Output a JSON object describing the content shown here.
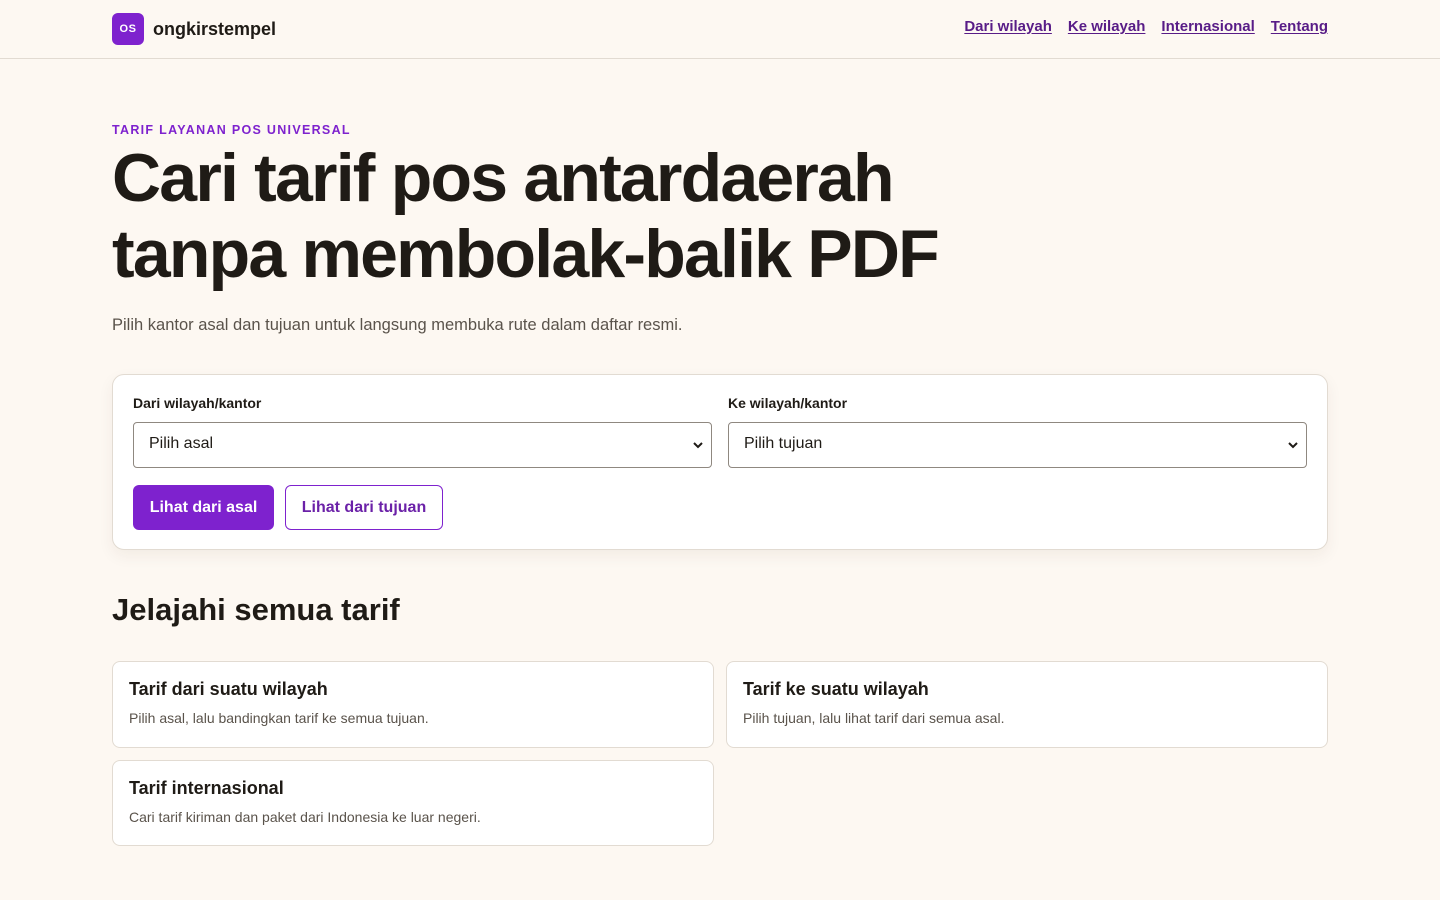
{
  "brand": {
    "logo_text": "OS",
    "name": "ongkirstempel"
  },
  "nav": [
    "Dari wilayah",
    "Ke wilayah",
    "Internasional",
    "Tentang"
  ],
  "hero": {
    "eyebrow": "TARIF LAYANAN POS UNIVERSAL",
    "headline": "Cari tarif pos antardaerah tanpa membolak-balik PDF",
    "lead": "Pilih kantor asal dan tujuan untuk langsung membuka rute dalam daftar resmi."
  },
  "search": {
    "origin": {
      "label": "Dari wilayah/kantor",
      "selected": "Pilih asal"
    },
    "destination": {
      "label": "Ke wilayah/kantor",
      "selected": "Pilih tujuan"
    },
    "primary_button": "Lihat dari asal",
    "secondary_button": "Lihat dari tujuan"
  },
  "explore": {
    "title": "Jelajahi semua tarif",
    "cards": [
      {
        "title": "Tarif dari suatu wilayah",
        "desc": "Pilih asal, lalu bandingkan tarif ke semua tujuan."
      },
      {
        "title": "Tarif ke suatu wilayah",
        "desc": "Pilih tujuan, lalu lihat tarif dari semua asal."
      },
      {
        "title": "Tarif internasional",
        "desc": "Cari tarif kiriman dan paket dari Indonesia ke luar negeri."
      }
    ]
  },
  "colors": {
    "accent": "#7e22ce",
    "link": "#581c87",
    "background": "#fdf8f2"
  }
}
